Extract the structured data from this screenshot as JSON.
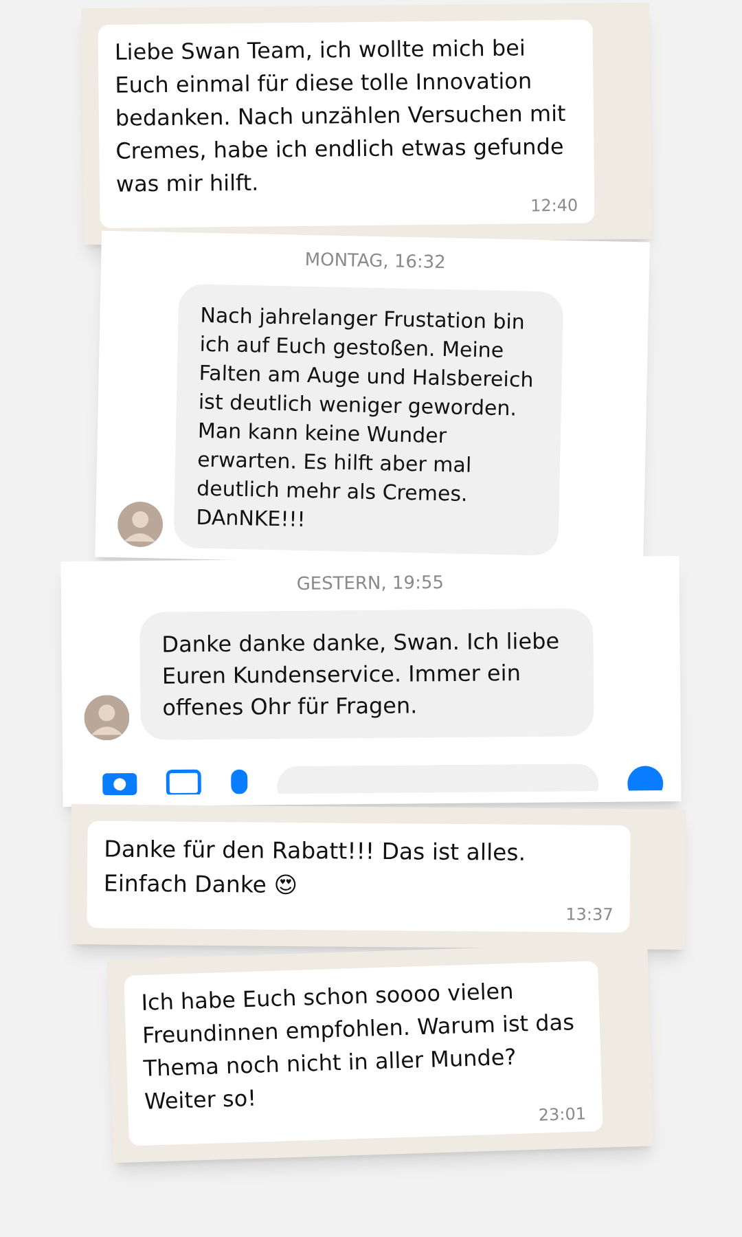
{
  "cards": [
    {
      "kind": "whatsapp",
      "text": "Liebe Swan Team, ich wollte mich bei Euch einmal für diese tolle Innovation bedanken. Nach unzählen Versuchen mit Cremes, habe ich endlich etwas gefunde was mir hilft.",
      "time": "12:40"
    },
    {
      "kind": "messenger",
      "date": "MONTAG, 16:32",
      "text": "Nach jahrelanger Frustation bin ich auf Euch gestoßen. Meine Falten am Auge und Halsbereich ist deutlich weniger geworden. Man kann keine Wunder erwarten. Es hilft aber mal deutlich mehr als Cremes. DAnNKE!!!",
      "composer": false
    },
    {
      "kind": "messenger",
      "date": "GESTERN, 19:55",
      "text": "Danke danke danke, Swan. Ich liebe Euren Kundenservice. Immer ein offenes Ohr für Fragen.",
      "composer": true
    },
    {
      "kind": "whatsapp",
      "text": "Danke für den Rabatt!!! Das ist alles. Einfach Danke 😍",
      "time": "13:37"
    },
    {
      "kind": "whatsapp",
      "text": "Ich habe Euch schon soooo vielen Freundinnen empfohlen. Warum ist das Thema noch nicht in aller Munde? Weiter so!",
      "time": "23:01"
    }
  ]
}
